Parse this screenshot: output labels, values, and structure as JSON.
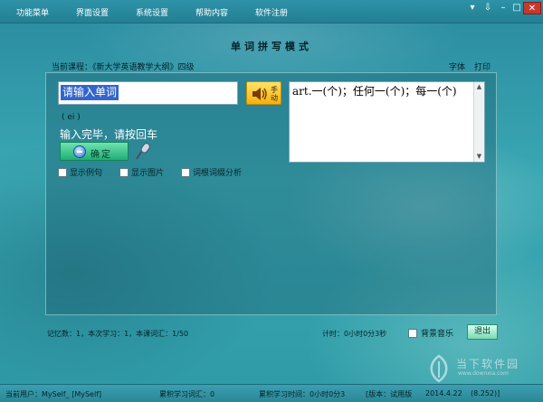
{
  "menu": {
    "items": [
      "功能菜单",
      "界面设置",
      "系统设置",
      "帮助内容",
      "软件注册"
    ]
  },
  "window_controls": {
    "menu": "▾",
    "pin": "⇩",
    "minimize": "–",
    "maximize": "□",
    "close": "✕"
  },
  "page_title": "单词拼写模式",
  "course": {
    "label": "当前课程：",
    "value": "《新大学英语教学大纲》四级"
  },
  "top_links": {
    "font": "字体",
    "print": "打印"
  },
  "word_input": {
    "value": "请输入单词"
  },
  "speaker_button": {
    "label": "手动"
  },
  "meaning": {
    "text": "art.一(个)；任何一(个)；每一(个)"
  },
  "phonetic": "( ei )",
  "hint": "输入完毕，请按回车",
  "ok_button": {
    "label": "确定"
  },
  "checkboxes": {
    "show_examples": "显示例句",
    "show_image": "显示图片",
    "root_analysis": "词根词缀分析"
  },
  "stats": "记忆数：1，本次学习：1，本课词汇：1/50",
  "timer": "计时：0小时0分3秒",
  "background_music": "背景音乐",
  "exit_button": "退出",
  "statusbar": {
    "user": "当前用户：MySelf_ [MySelf]",
    "total_words": "累积学习词汇：0",
    "total_time": "累积学习时间：0小时0分3",
    "version": "[版本：试用版",
    "date": "2014.4.22",
    "build": "(8.252)]"
  },
  "watermark": {
    "line1": "当下软件园",
    "line2": "www.downxia.com"
  },
  "colors": {
    "background": "#3aa8b3",
    "menubar": "#237f93",
    "selection": "#3366cc",
    "ok_button": "#1fae74",
    "speaker_button": "#f3b10e",
    "close_button": "#c43a2e"
  },
  "icons": [
    "speaker-icon",
    "ok-circle-icon",
    "microphone-icon",
    "scroll-up-icon",
    "scroll-down-icon",
    "leaf-logo-icon"
  ]
}
